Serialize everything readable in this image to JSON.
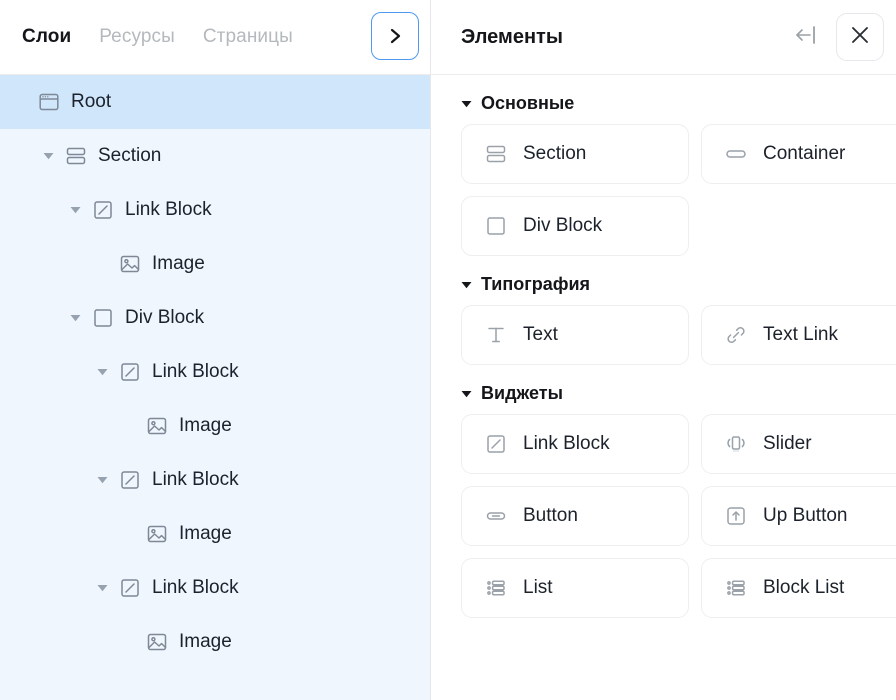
{
  "left_panel": {
    "tabs": [
      {
        "label": "Слои",
        "active": true
      },
      {
        "label": "Ресурсы",
        "active": false
      },
      {
        "label": "Страницы",
        "active": false
      }
    ],
    "next_tabs_button": {
      "icon": "chevron-right-icon",
      "accent_color": "#4f9af0"
    },
    "tree": [
      {
        "label": "Root",
        "icon": "browser-window-icon",
        "depth": 0,
        "expanded": null,
        "selected": true
      },
      {
        "label": "Section",
        "icon": "section-icon",
        "depth": 1,
        "expanded": true,
        "selected": false
      },
      {
        "label": "Link Block",
        "icon": "link-block-icon",
        "depth": 2,
        "expanded": true,
        "selected": false
      },
      {
        "label": "Image",
        "icon": "image-icon",
        "depth": 3,
        "expanded": null,
        "selected": false
      },
      {
        "label": "Div Block",
        "icon": "div-block-icon",
        "depth": 2,
        "expanded": true,
        "selected": false
      },
      {
        "label": "Link Block",
        "icon": "link-block-icon",
        "depth": 3,
        "expanded": true,
        "selected": false
      },
      {
        "label": "Image",
        "icon": "image-icon",
        "depth": 4,
        "expanded": null,
        "selected": false
      },
      {
        "label": "Link Block",
        "icon": "link-block-icon",
        "depth": 3,
        "expanded": true,
        "selected": false
      },
      {
        "label": "Image",
        "icon": "image-icon",
        "depth": 4,
        "expanded": null,
        "selected": false
      },
      {
        "label": "Link Block",
        "icon": "link-block-icon",
        "depth": 3,
        "expanded": true,
        "selected": false
      },
      {
        "label": "Image",
        "icon": "image-icon",
        "depth": 4,
        "expanded": null,
        "selected": false
      }
    ],
    "selected_row_color": "#cfe6fb",
    "panel_background": "#eff6fd"
  },
  "right_panel": {
    "title": "Элементы",
    "collapse_button": {
      "icon": "collapse-to-right-icon"
    },
    "close_button": {
      "icon": "close-icon"
    },
    "groups": [
      {
        "title": "Основные",
        "expanded": true,
        "items": [
          {
            "label": "Section",
            "icon": "section-icon"
          },
          {
            "label": "Container",
            "icon": "container-icon"
          },
          {
            "label": "Div Block",
            "icon": "div-block-icon"
          }
        ]
      },
      {
        "title": "Типография",
        "expanded": true,
        "items": [
          {
            "label": "Text",
            "icon": "text-icon"
          },
          {
            "label": "Text Link",
            "icon": "text-link-icon"
          }
        ]
      },
      {
        "title": "Виджеты",
        "expanded": true,
        "items": [
          {
            "label": "Link Block",
            "icon": "link-block-icon"
          },
          {
            "label": "Slider",
            "icon": "slider-icon"
          },
          {
            "label": "Button",
            "icon": "button-icon"
          },
          {
            "label": "Up Button",
            "icon": "up-button-icon"
          },
          {
            "label": "List",
            "icon": "list-icon"
          },
          {
            "label": "Block List",
            "icon": "block-list-icon"
          }
        ]
      }
    ]
  }
}
